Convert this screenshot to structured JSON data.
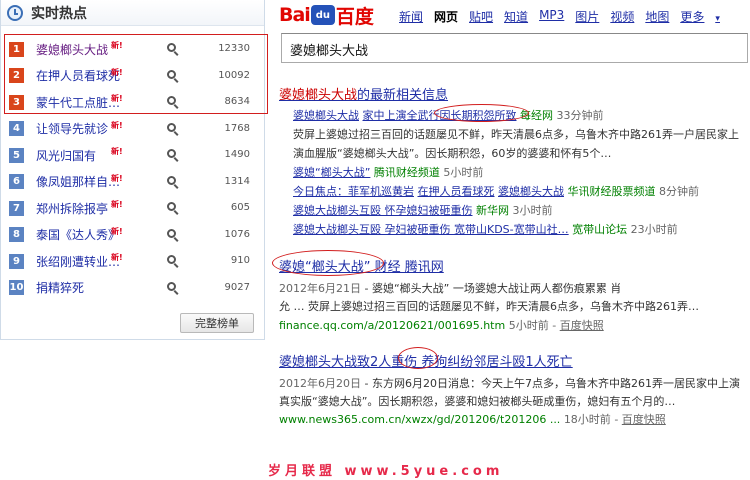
{
  "hot": {
    "title": "实时热点",
    "more_label": "完整榜单",
    "new_label": "新!",
    "items": [
      {
        "rank": "1",
        "word": "婆媳榔头大战",
        "count": "12330"
      },
      {
        "rank": "2",
        "word": "在押人员看球死",
        "count": "10092"
      },
      {
        "rank": "3",
        "word": "蒙牛代工点脏…",
        "count": "8634"
      },
      {
        "rank": "4",
        "word": "让领导先就诊",
        "count": "1768"
      },
      {
        "rank": "5",
        "word": "风光归国有",
        "count": "1490"
      },
      {
        "rank": "6",
        "word": "像凤姐那样自…",
        "count": "1314"
      },
      {
        "rank": "7",
        "word": "郑州拆除报亭",
        "count": "605"
      },
      {
        "rank": "8",
        "word": "泰国《达人秀》",
        "count": "1076"
      },
      {
        "rank": "9",
        "word": "张绍刚遭转业…",
        "count": "910"
      },
      {
        "rank": "10",
        "word": "捐精猝死",
        "count": "9027"
      }
    ]
  },
  "baidu": {
    "logo_bai": "Bai",
    "logo_paw": "du",
    "logo_du": "百度",
    "nav": [
      "新闻",
      "网页",
      "贴吧",
      "知道",
      "MP3",
      "图片",
      "视频",
      "地图",
      "更多"
    ],
    "nav_more_arrow": "▾",
    "query": "婆媳榔头大战"
  },
  "news_block": {
    "title_em": "婆媳榔头大战",
    "title_rest": "的最新相关信息",
    "item1_em": "婆媳榔头大战",
    "item1_link": "家中上演全武行因长期积怨所致",
    "item1_src": "每经网",
    "item1_time": "33分钟前",
    "snip1_a": "荧屏上婆媳过招三百回的话题屡见不鲜，昨天清晨6点多，乌鲁木齐中路261弄一户居民家上",
    "snip1_b": "演血腥版“婆媳榔头大战”。因长期积怨，60岁的婆婆和怀有5个…",
    "item2_link": "婆媳“榔头大战”",
    "item2_src": "腾讯财经频道",
    "item2_time": "5小时前",
    "item3_a": "今日焦点：菲军机巡黄岩",
    "item3_b": "在押人员看球死",
    "item3_c": "婆媳榔头大战",
    "item3_src": "华讯财经股票频道",
    "item3_time": "8分钟前",
    "item4_link": "婆媳大战榔头互殴 怀孕媳妇被砸重伤",
    "item4_src": "新华网",
    "item4_time": "3小时前",
    "item5_link": "婆媳大战榔头互殴 孕妇被砸重伤 宽带山KDS-宽带山社…",
    "item5_src": "宽带山论坛",
    "item5_time": "23小时前"
  },
  "result2": {
    "title": "婆媳“榔头大战” 财经 腾讯网",
    "date": "2012年6月21日",
    "snip_a": " - 婆媳“榔头大战” 一场婆媳大战让两人都伤痕累累 肖",
    "snip_b": "允 … 荧屏上婆媳过招三百回的话题屡见不鲜，昨天清晨6点多，乌鲁木齐中路261弄…",
    "url": "finance.qq.com/a/20120621/001695.htm",
    "time": "5小时前",
    "cache": "百度快照"
  },
  "result3": {
    "title": "婆媳榔头大战致2人重伤 养狗纠纷邻居斗殴1人死亡",
    "date": "2012年6月20日",
    "snip_a": " - 东方网6月20日消息：今天上午7点多，乌鲁木齐中路261弄一居民家中上演",
    "snip_b": "真实版“婆媳大战”。因长期积怨，婆婆和媳妇被榔头砸成重伤，媳妇有五个月的…",
    "url": "www.news365.com.cn/xwzx/gd/201206/t201206 ...",
    "time": "18小时前",
    "cache": "百度快照"
  },
  "watermark": "岁月联盟 www.5yue.com"
}
